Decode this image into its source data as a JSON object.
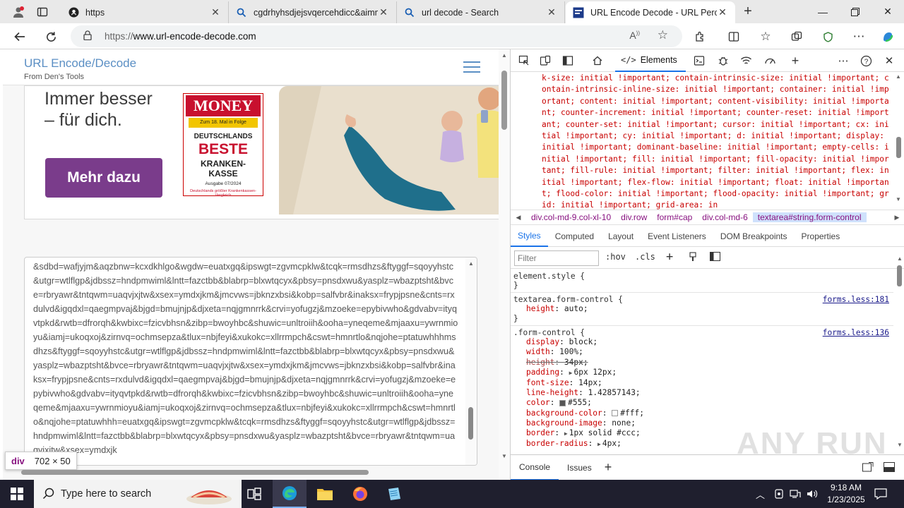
{
  "browser": {
    "tabs": [
      {
        "title": "https",
        "icon": "github-icon"
      },
      {
        "title": "cgdrhyhsdjejsvqercehdicc&aimn",
        "icon": "search-icon"
      },
      {
        "title": "url decode - Search",
        "icon": "search-icon"
      },
      {
        "title": "URL Encode Decode - URL Percent",
        "icon": "site-icon",
        "active": true
      }
    ],
    "address": {
      "prefix": "https://",
      "host": "www.url-encode-decode.com"
    }
  },
  "site": {
    "title": "URL Encode/Decode",
    "subtitle": "From Den's Tools"
  },
  "ad": {
    "headline": "Immer besser\n– für dich.",
    "button": "Mehr dazu",
    "badge": {
      "brand": "MONEY",
      "tag": "Zum 18. Mal in Folge",
      "line1": "DEUTSCHLANDS",
      "line2": "BESTE",
      "line3": "KRANKEN-\nKASSE",
      "issue": "Ausgabe 07/2024",
      "footer": "Deutschlands größter Krankenkassen-Vergleich"
    },
    "brand_color": "#7a3c8b"
  },
  "textarea": {
    "content": "&sdbd=wafjyjm&aqzbnw=kcxdkhlgo&wgdw=euatxgq&ipswgt=zgvmcpklw&tcqk=rmsdhzs&ftyggf=sqoyyhstc&utgr=wtlflgp&jdbssz=hndpmwiml&lntt=fazctbb&blabrp=blxwtqcyx&pbsy=pnsdxwu&yasplz=wbazptsht&bvce=rbryawr&tntqwm=uaqvjxjtw&xsex=ymdxjkm&jmcvws=jbknzxbsi&kobp=salfvbr&inaksx=frypjpsne&cnts=rxdulvd&igqdxl=qaegmpvaj&bjgd=bmujnjp&djxeta=nqjgmnrrk&crvi=yofugzj&mzoeke=epybivwho&gdvabv=ityqvtpkd&rwtb=dfrorqh&kwbixc=fzicvbhsn&zibp=bwoyhbc&shuwic=unltroiih&ooha=yneqeme&mjaaxu=ywrnmioyu&iamj=ukoqxoj&zirnvq=ochmsepza&tlux=nbjfeyi&xukokc=xllrrmpch&cswt=hmnrtlo&nqjohe=ptatuwhhhmsdhzs&ftyggf=sqoyyhstc&utgr=wtlflgp&jdbssz=hndpmwiml&lntt=fazctbb&blabrp=blxwtqcyx&pbsy=pnsdxwu&yasplz=wbazptsht&bvce=rbryawr&tntqwm=uaqvjxjtw&xsex=ymdxjkm&jmcvws=jbknzxbsi&kobp=salfvbr&inaksx=frypjpsne&cnts=rxdulvd&igqdxl=qaegmpvaj&bjgd=bmujnjp&djxeta=nqjgmnrrk&crvi=yofugzj&mzoeke=epybivwho&gdvabv=ityqvtpkd&rwtb=dfrorqh&kwbixc=fzicvbhsn&zibp=bwoyhbc&shuwic=unltroiih&ooha=yneqeme&mjaaxu=ywrnmioyu&iamj=ukoqxoj&zirnvq=ochmsepza&tlux=nbjfeyi&xukokc=xllrrmpch&cswt=hmnrtlo&nqjohe=ptatuwhhh=euatxgq&ipswgt=zgvmcpklw&tcqk=rmsdhzs&ftyggf=sqoyyhstc&utgr=wtlflgp&jdbssz=hndpmwiml&lntt=fazctbb&blabrp=blxwtqcyx&pbsy=pnsdxwu&yasplz=wbazptsht&bvce=rbryawr&tntqwm=uaqvjxjtw&xsex=ymdxjk"
  },
  "inspect_tooltip": {
    "tag": "div",
    "size": "702 × 50"
  },
  "devtools": {
    "active_tab": "Elements",
    "css_dump": "k-size: initial !important; contain-intrinsic-size: initial !important; contain-intrinsic-inline-size: initial !important; container: initial !important; content: initial !important; content-visibility: initial !important; counter-increment: initial !important; counter-reset: initial !important; counter-set: initial !important; cursor: initial !important; cx: initial !important; cy: initial !important; d: initial !important; display: initial !important; dominant-baseline: initial !important; empty-cells: initial !important; fill: initial !important; fill-opacity: initial !important; fill-rule: initial !important; filter: initial !important; flex: initial !important; flex-flow: initial !important; float: initial !important; flood-color: initial !important; flood-opacity: initial !important; grid: initial !important; grid-area: in",
    "breadcrumbs": [
      "div.col-md-9.col-xl-10",
      "div.row",
      "form#cap",
      "div.col-md-6",
      "textarea#string.form-control"
    ],
    "subtabs": [
      "Styles",
      "Computed",
      "Layout",
      "Event Listeners",
      "DOM Breakpoints",
      "Properties"
    ],
    "filter_placeholder": "Filter",
    "tools": {
      "hov": ":hov",
      "cls": ".cls"
    },
    "element_style": {
      "selector": "element.style {",
      "close": "}"
    },
    "rule1": {
      "selector": "textarea.form-control {",
      "source": "forms.less:181",
      "decls": [
        {
          "p": "height",
          "v": "auto;"
        }
      ],
      "close": "}"
    },
    "rule2": {
      "selector": ".form-control {",
      "source": "forms.less:136",
      "decls": [
        {
          "p": "display",
          "v": "block;"
        },
        {
          "p": "width",
          "v": "100%;"
        },
        {
          "p": "height",
          "v": "34px;"
        },
        {
          "p": "padding",
          "v": "6px 12px;"
        },
        {
          "p": "font-size",
          "v": "14px;"
        },
        {
          "p": "line-height",
          "v": "1.42857143;"
        },
        {
          "p": "color",
          "v": "#555;"
        },
        {
          "p": "background-color",
          "v": "#fff;"
        },
        {
          "p": "background-image",
          "v": "none;"
        },
        {
          "p": "border",
          "v": "1px solid #ccc;"
        },
        {
          "p": "border-radius",
          "v": "4px;"
        }
      ]
    },
    "drawer": [
      "Console",
      "Issues"
    ],
    "watermark": "ANY RUN"
  },
  "taskbar": {
    "search_placeholder": "Type here to search",
    "time": "9:18 AM",
    "date": "1/23/2025"
  }
}
